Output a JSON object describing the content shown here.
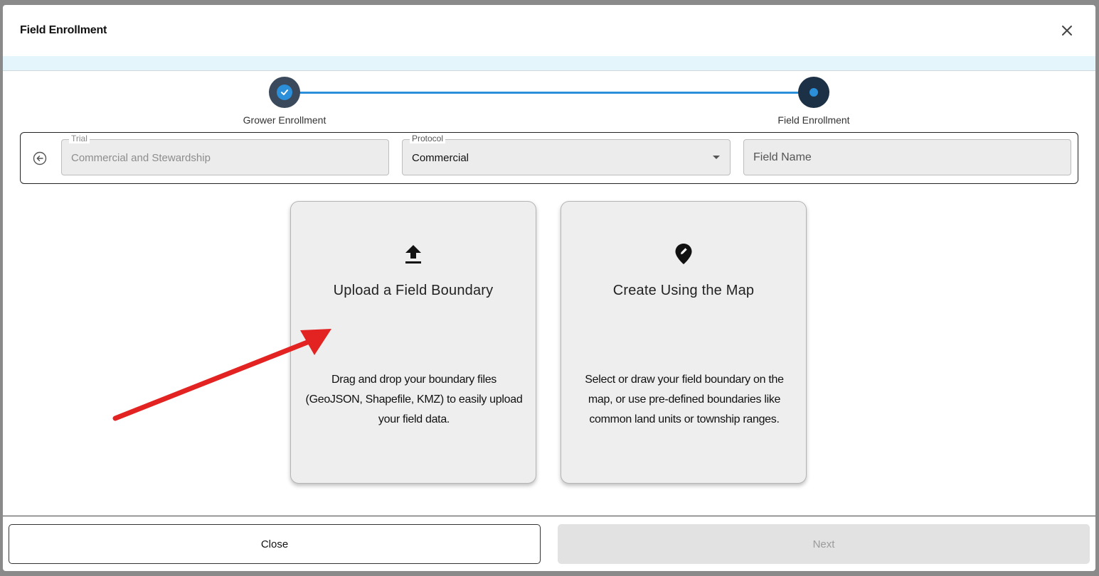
{
  "modal": {
    "title": "Field Enrollment"
  },
  "stepper": {
    "steps": [
      {
        "label": "Grower Enrollment",
        "state": "completed"
      },
      {
        "label": "Field Enrollment",
        "state": "active"
      }
    ]
  },
  "form": {
    "trial": {
      "label": "Trial",
      "value": "Commercial and Stewardship"
    },
    "protocol": {
      "label": "Protocol",
      "value": "Commercial"
    },
    "field_name": {
      "placeholder": "Field Name",
      "value": ""
    }
  },
  "cards": [
    {
      "icon": "upload-icon",
      "title": "Upload a Field Boundary",
      "description": "Drag and drop your boundary files (GeoJSON, Shapefile, KMZ) to easily upload your field data."
    },
    {
      "icon": "map-pin-edit-icon",
      "title": "Create Using the Map",
      "description": "Select or draw your field boundary on the map, or use pre-defined boundaries like common land units or township ranges."
    }
  ],
  "footer": {
    "close_label": "Close",
    "next_label": "Next"
  },
  "colors": {
    "accent": "#2b8fd9",
    "annotation_arrow": "#e32222",
    "step_circle": "#3a4a5c",
    "info_strip": "#e4f5fc"
  }
}
